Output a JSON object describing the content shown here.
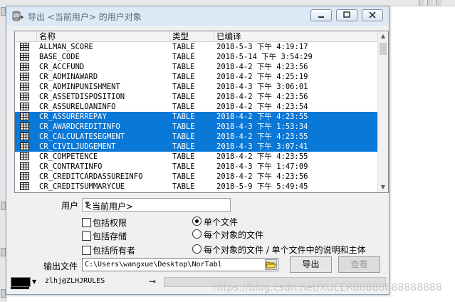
{
  "window": {
    "title": "导出 <当前用户> 的用户对象"
  },
  "list": {
    "headers": [
      "名称",
      "类型",
      "已编译"
    ],
    "rows": [
      {
        "name": "ALLMAN_SCORE",
        "type": "TABLE",
        "compiled": "2018-5-3 下午 4:19:17",
        "selected": false
      },
      {
        "name": "BASE_CODE",
        "type": "TABLE",
        "compiled": "2018-5-14 下午 3:54:29",
        "selected": false
      },
      {
        "name": "CR_ACCFUND",
        "type": "TABLE",
        "compiled": "2018-4-2 下午 4:23:56",
        "selected": false
      },
      {
        "name": "CR_ADMINAWARD",
        "type": "TABLE",
        "compiled": "2018-4-2 下午 4:25:19",
        "selected": false
      },
      {
        "name": "CR_ADMINPUNISHMENT",
        "type": "TABLE",
        "compiled": "2018-4-3 下午 3:06:01",
        "selected": false
      },
      {
        "name": "CR_ASSETDISPOSITION",
        "type": "TABLE",
        "compiled": "2018-4-2 下午 4:23:56",
        "selected": false
      },
      {
        "name": "CR_ASSURELOANINFO",
        "type": "TABLE",
        "compiled": "2018-4-2 下午 4:23:54",
        "selected": false
      },
      {
        "name": "CR_ASSURERREPAY",
        "type": "TABLE",
        "compiled": "2018-4-2 下午 4:23:55",
        "selected": true
      },
      {
        "name": "CR_AWARDCREDITINFO",
        "type": "TABLE",
        "compiled": "2018-4-3 下午 1:53:34",
        "selected": true
      },
      {
        "name": "CR_CALCULATESEGMENT",
        "type": "TABLE",
        "compiled": "2018-4-2 下午 4:23:55",
        "selected": true
      },
      {
        "name": "CR_CIVILJUDGEMENT",
        "type": "TABLE",
        "compiled": "2018-4-3 下午 3:07:41",
        "selected": true
      },
      {
        "name": "CR_COMPETENCE",
        "type": "TABLE",
        "compiled": "2018-4-2 下午 4:23:55",
        "selected": false
      },
      {
        "name": "CR_CONTRATINFO",
        "type": "TABLE",
        "compiled": "2018-4-3 下午 1:47:09",
        "selected": false
      },
      {
        "name": "CR_CREDITCARDASSUREINFO",
        "type": "TABLE",
        "compiled": "2018-4-2 下午 4:23:56",
        "selected": false
      },
      {
        "name": "CR_CREDITSUMMARYCUE",
        "type": "TABLE",
        "compiled": "2018-5-9 下午 5:49:45",
        "selected": false
      }
    ]
  },
  "options": {
    "user_label": "用户",
    "user_value": "<当前用户>",
    "checkboxes": [
      "包括权限",
      "包括存储",
      "包括所有者"
    ],
    "radios": [
      "单个文件",
      "每个对象的文件",
      "每个对象的文件 / 单个文件中的说明和主体"
    ],
    "radio_selected": 0,
    "output_label": "输出文件",
    "output_path": "C:\\Users\\wangxue\\Desktop\\NorTabl"
  },
  "buttons": {
    "export": "导出",
    "view": "查看"
  },
  "statusbar": {
    "connection": "zlhj@ZLHJRULES"
  },
  "watermark": "https://blog.csdn.net/XUEER88888888888888",
  "colors": {
    "selection": "#0a78d7",
    "titlebar": "#dde9f5"
  }
}
